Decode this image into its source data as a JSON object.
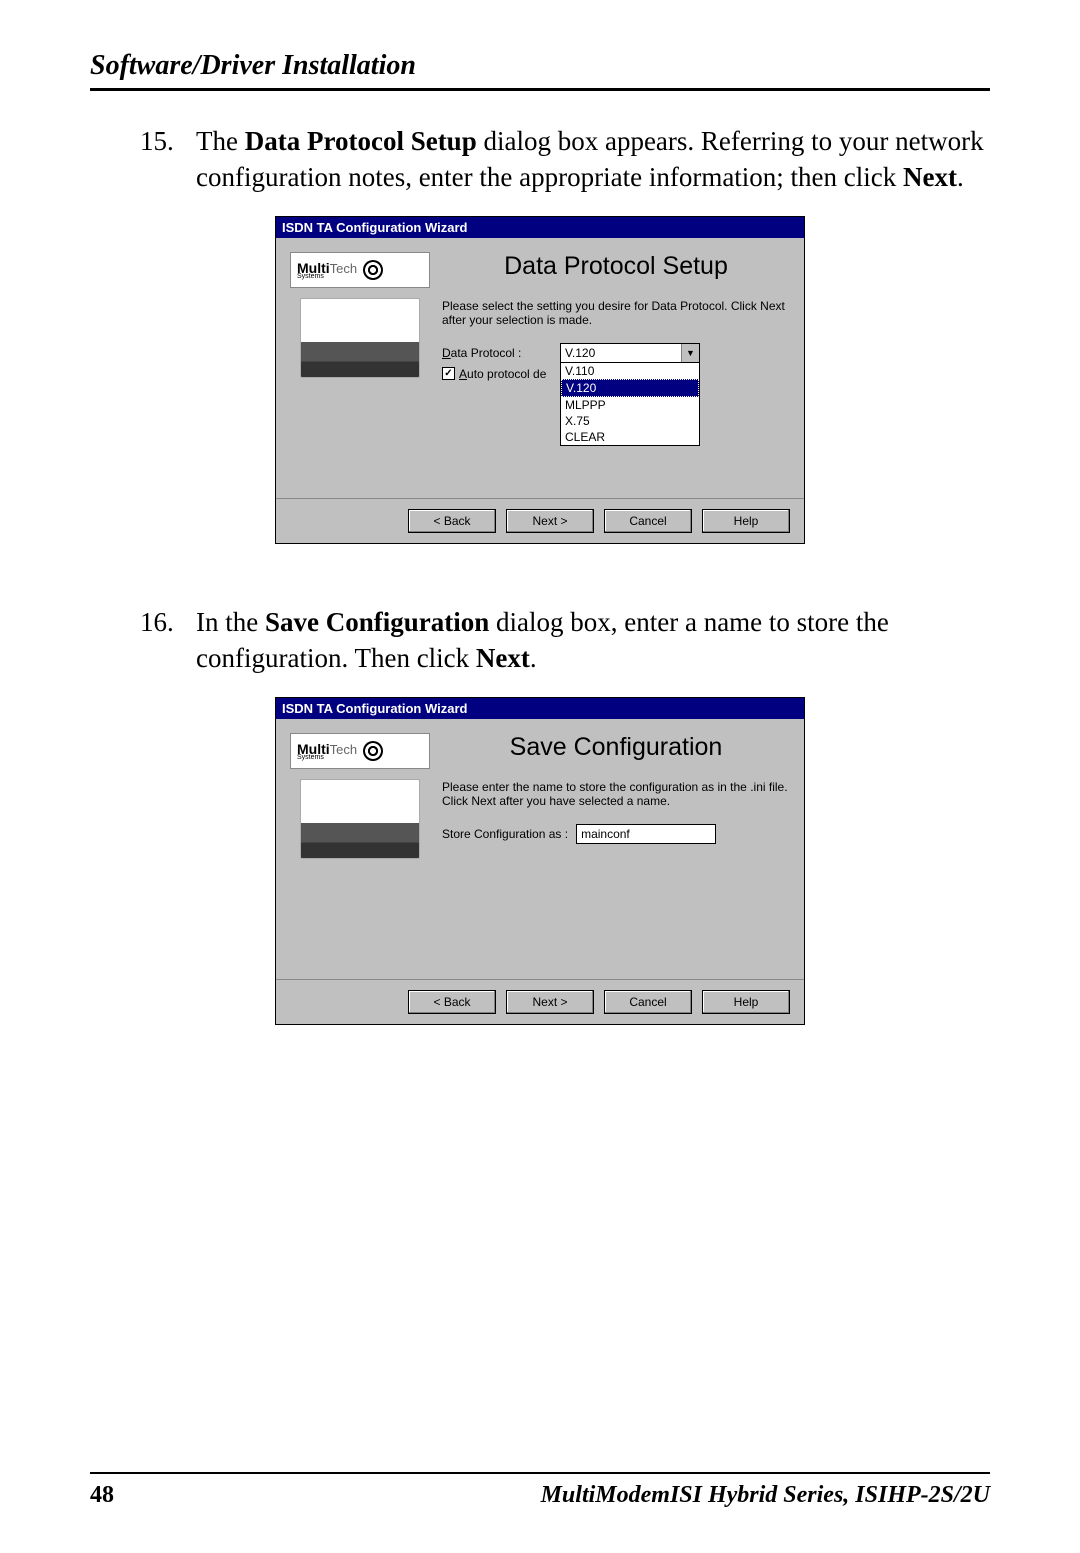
{
  "header": {
    "title": "Software/Driver Installation"
  },
  "steps": [
    {
      "num": "15.",
      "parts": [
        "The ",
        "Data Protocol Setup",
        " dialog box appears. Referring to your network configuration notes, enter the appropriate information; then click ",
        "Next",
        "."
      ]
    },
    {
      "num": "16.",
      "parts": [
        "In the ",
        "Save Configuration",
        " dialog box, enter a name to store the configuration. Then click ",
        "Next",
        "."
      ]
    }
  ],
  "dialog1": {
    "titlebar": "ISDN TA Configuration Wizard",
    "logo": {
      "multi": "Multi",
      "tech": "Tech",
      "systems": "Systems"
    },
    "panel_title": "Data Protocol Setup",
    "instruction": "Please select the setting you desire for Data Protocol. Click Next after your selection is made.",
    "field_label": "Data Protocol :",
    "combo_value": "V.120",
    "dropdown": [
      "V.110",
      "V.120",
      "MLPPP",
      "X.75",
      "CLEAR"
    ],
    "checkbox_label": "Auto protocol de",
    "checkbox_checked": "✓",
    "buttons": {
      "back": "< Back",
      "next": "Next >",
      "cancel": "Cancel",
      "help": "Help"
    }
  },
  "dialog2": {
    "titlebar": "ISDN TA Configuration Wizard",
    "logo": {
      "multi": "Multi",
      "tech": "Tech",
      "systems": "Systems"
    },
    "panel_title": "Save Configuration",
    "instruction": "Please enter the name to store the configuration as in the .ini file.  Click Next after you have selected a name.",
    "field_label": "Store Configuration as :",
    "input_value": "mainconf",
    "buttons": {
      "back": "< Back",
      "next": "Next >",
      "cancel": "Cancel",
      "help": "Help"
    }
  },
  "footer": {
    "page": "48",
    "title": "MultiModemISI Hybrid Series, ISIHP-2S/2U"
  },
  "chart_data": null
}
